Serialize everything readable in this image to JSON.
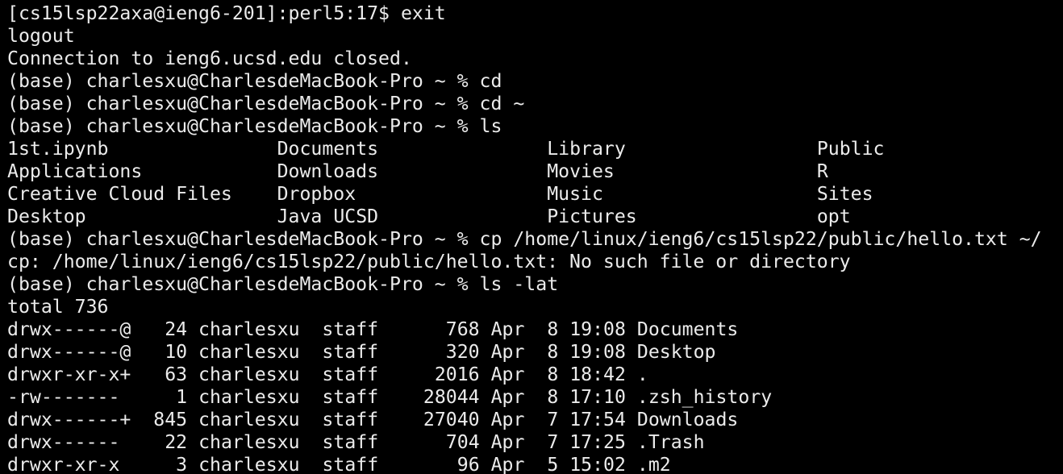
{
  "terminal": {
    "colors": {
      "background": "#000000",
      "foreground": "#ebebeb"
    },
    "lines": [
      {
        "kind": "command",
        "segments": [
          {
            "role": "prompt",
            "text": "[cs15lsp22axa@ieng6-201]:perl5:17$ "
          },
          {
            "role": "command",
            "text": "exit"
          }
        ]
      },
      {
        "kind": "output",
        "segments": [
          {
            "role": "text",
            "text": "logout"
          }
        ]
      },
      {
        "kind": "output",
        "segments": [
          {
            "role": "text",
            "text": "Connection to ieng6.ucsd.edu closed."
          }
        ]
      },
      {
        "kind": "command",
        "segments": [
          {
            "role": "prompt",
            "text": "(base) charlesxu@CharlesdeMacBook-Pro ~ % "
          },
          {
            "role": "command",
            "text": "cd"
          }
        ]
      },
      {
        "kind": "command",
        "segments": [
          {
            "role": "prompt",
            "text": "(base) charlesxu@CharlesdeMacBook-Pro ~ % "
          },
          {
            "role": "command",
            "text": "cd ~"
          }
        ]
      },
      {
        "kind": "command",
        "segments": [
          {
            "role": "prompt",
            "text": "(base) charlesxu@CharlesdeMacBook-Pro ~ % "
          },
          {
            "role": "command",
            "text": "ls"
          }
        ]
      },
      {
        "kind": "ls-row",
        "segments": [
          {
            "role": "entry",
            "text": "1st.ipynb"
          },
          {
            "role": "entry",
            "text": "Documents"
          },
          {
            "role": "entry",
            "text": "Library"
          },
          {
            "role": "entry",
            "text": "Public"
          }
        ]
      },
      {
        "kind": "ls-row",
        "segments": [
          {
            "role": "entry",
            "text": "Applications"
          },
          {
            "role": "entry",
            "text": "Downloads"
          },
          {
            "role": "entry",
            "text": "Movies"
          },
          {
            "role": "entry",
            "text": "R"
          }
        ]
      },
      {
        "kind": "ls-row",
        "segments": [
          {
            "role": "entry",
            "text": "Creative Cloud Files"
          },
          {
            "role": "entry",
            "text": "Dropbox"
          },
          {
            "role": "entry",
            "text": "Music"
          },
          {
            "role": "entry",
            "text": "Sites"
          }
        ]
      },
      {
        "kind": "ls-row",
        "segments": [
          {
            "role": "entry",
            "text": "Desktop"
          },
          {
            "role": "entry",
            "text": "Java UCSD"
          },
          {
            "role": "entry",
            "text": "Pictures"
          },
          {
            "role": "entry",
            "text": "opt"
          }
        ]
      },
      {
        "kind": "command",
        "segments": [
          {
            "role": "prompt",
            "text": "(base) charlesxu@CharlesdeMacBook-Pro ~ % "
          },
          {
            "role": "command",
            "text": "cp /home/linux/ieng6/cs15lsp22/public/hello.txt ~/"
          }
        ]
      },
      {
        "kind": "output",
        "segments": [
          {
            "role": "text",
            "text": "cp: /home/linux/ieng6/cs15lsp22/public/hello.txt: No such file or directory"
          }
        ]
      },
      {
        "kind": "command",
        "segments": [
          {
            "role": "prompt",
            "text": "(base) charlesxu@CharlesdeMacBook-Pro ~ % "
          },
          {
            "role": "command",
            "text": "ls -lat"
          }
        ]
      },
      {
        "kind": "output",
        "segments": [
          {
            "role": "text",
            "text": "total 736"
          }
        ]
      },
      {
        "kind": "listing-row",
        "segments": [
          {
            "role": "perms",
            "text": "drwx------@"
          },
          {
            "role": "links",
            "text": "24"
          },
          {
            "role": "owner",
            "text": "charlesxu"
          },
          {
            "role": "group",
            "text": "staff"
          },
          {
            "role": "size",
            "text": "768"
          },
          {
            "role": "month",
            "text": "Apr"
          },
          {
            "role": "day",
            "text": "8"
          },
          {
            "role": "time",
            "text": "19:08"
          },
          {
            "role": "name",
            "text": "Documents"
          }
        ]
      },
      {
        "kind": "listing-row",
        "segments": [
          {
            "role": "perms",
            "text": "drwx------@"
          },
          {
            "role": "links",
            "text": "10"
          },
          {
            "role": "owner",
            "text": "charlesxu"
          },
          {
            "role": "group",
            "text": "staff"
          },
          {
            "role": "size",
            "text": "320"
          },
          {
            "role": "month",
            "text": "Apr"
          },
          {
            "role": "day",
            "text": "8"
          },
          {
            "role": "time",
            "text": "19:08"
          },
          {
            "role": "name",
            "text": "Desktop"
          }
        ]
      },
      {
        "kind": "listing-row",
        "segments": [
          {
            "role": "perms",
            "text": "drwxr-xr-x+"
          },
          {
            "role": "links",
            "text": "63"
          },
          {
            "role": "owner",
            "text": "charlesxu"
          },
          {
            "role": "group",
            "text": "staff"
          },
          {
            "role": "size",
            "text": "2016"
          },
          {
            "role": "month",
            "text": "Apr"
          },
          {
            "role": "day",
            "text": "8"
          },
          {
            "role": "time",
            "text": "18:42"
          },
          {
            "role": "name",
            "text": "."
          }
        ]
      },
      {
        "kind": "listing-row",
        "segments": [
          {
            "role": "perms",
            "text": "-rw-------"
          },
          {
            "role": "links",
            "text": "1"
          },
          {
            "role": "owner",
            "text": "charlesxu"
          },
          {
            "role": "group",
            "text": "staff"
          },
          {
            "role": "size",
            "text": "28044"
          },
          {
            "role": "month",
            "text": "Apr"
          },
          {
            "role": "day",
            "text": "8"
          },
          {
            "role": "time",
            "text": "17:10"
          },
          {
            "role": "name",
            "text": ".zsh_history"
          }
        ]
      },
      {
        "kind": "listing-row",
        "segments": [
          {
            "role": "perms",
            "text": "drwx------+"
          },
          {
            "role": "links",
            "text": "845"
          },
          {
            "role": "owner",
            "text": "charlesxu"
          },
          {
            "role": "group",
            "text": "staff"
          },
          {
            "role": "size",
            "text": "27040"
          },
          {
            "role": "month",
            "text": "Apr"
          },
          {
            "role": "day",
            "text": "7"
          },
          {
            "role": "time",
            "text": "17:54"
          },
          {
            "role": "name",
            "text": "Downloads"
          }
        ]
      },
      {
        "kind": "listing-row",
        "segments": [
          {
            "role": "perms",
            "text": "drwx------"
          },
          {
            "role": "links",
            "text": "22"
          },
          {
            "role": "owner",
            "text": "charlesxu"
          },
          {
            "role": "group",
            "text": "staff"
          },
          {
            "role": "size",
            "text": "704"
          },
          {
            "role": "month",
            "text": "Apr"
          },
          {
            "role": "day",
            "text": "7"
          },
          {
            "role": "time",
            "text": "17:25"
          },
          {
            "role": "name",
            "text": ".Trash"
          }
        ]
      },
      {
        "kind": "listing-row",
        "segments": [
          {
            "role": "perms",
            "text": "drwxr-xr-x"
          },
          {
            "role": "links",
            "text": "3"
          },
          {
            "role": "owner",
            "text": "charlesxu"
          },
          {
            "role": "group",
            "text": "staff"
          },
          {
            "role": "size",
            "text": "96"
          },
          {
            "role": "month",
            "text": "Apr"
          },
          {
            "role": "day",
            "text": "5"
          },
          {
            "role": "time",
            "text": "15:02"
          },
          {
            "role": "name",
            "text": ".m2"
          }
        ]
      }
    ]
  }
}
